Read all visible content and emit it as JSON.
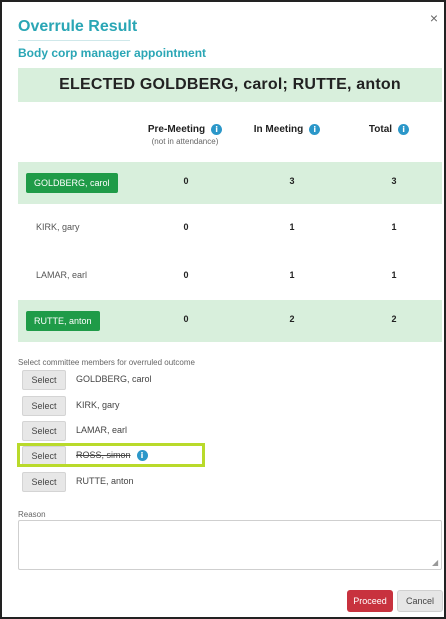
{
  "dialog": {
    "title": "Overrule Result",
    "subtitle": "Body corp manager appointment",
    "banner": "ELECTED GOLDBERG, carol;  RUTTE, anton",
    "close_glyph": "×",
    "info_glyph": "i"
  },
  "columns": {
    "pre_meeting": "Pre-Meeting",
    "pre_meeting_sub": "(not in attendance)",
    "in_meeting": "In Meeting",
    "total": "Total"
  },
  "results": [
    {
      "name": "GOLDBERG, carol",
      "elected": true,
      "pre": "0",
      "in": "3",
      "total": "3"
    },
    {
      "name": "KIRK, gary",
      "elected": false,
      "pre": "0",
      "in": "1",
      "total": "1"
    },
    {
      "name": "LAMAR, earl",
      "elected": false,
      "pre": "0",
      "in": "1",
      "total": "1"
    },
    {
      "name": "RUTTE, anton",
      "elected": true,
      "pre": "0",
      "in": "2",
      "total": "2"
    }
  ],
  "selection": {
    "label": "Select committee members for overruled outcome",
    "button_label": "Select",
    "members": [
      {
        "name": "GOLDBERG, carol",
        "struck": false
      },
      {
        "name": "KIRK, gary",
        "struck": false
      },
      {
        "name": "LAMAR, earl",
        "struck": false
      },
      {
        "name": "ROSS, simon",
        "struck": true
      },
      {
        "name": "RUTTE, anton",
        "struck": false
      }
    ]
  },
  "reason": {
    "label": "Reason",
    "value": "",
    "resize_glyph": "◢"
  },
  "actions": {
    "proceed": "Proceed",
    "cancel": "Cancel"
  },
  "colors": {
    "accent_teal": "#2aa6b5",
    "elected_green": "#1f9b48",
    "row_highlight": "#d8efdc",
    "proceed_red": "#c8323e",
    "highlight_box": "#b9da2a",
    "info_blue": "#2b97c9"
  }
}
